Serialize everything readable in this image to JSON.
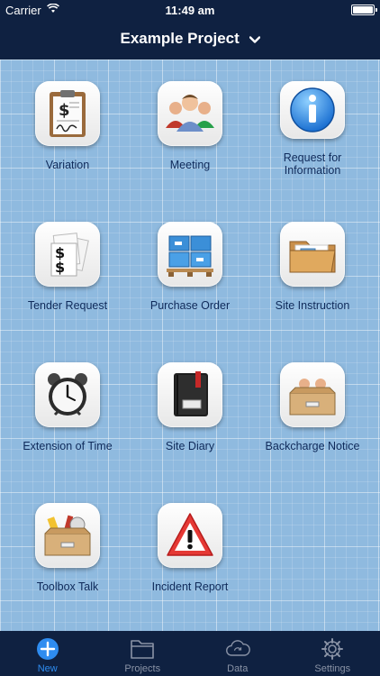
{
  "status": {
    "carrier": "Carrier",
    "time": "11:49 am"
  },
  "header": {
    "title": "Example Project"
  },
  "tiles": [
    {
      "label": "Variation",
      "icon": "clipboard-icon"
    },
    {
      "label": "Meeting",
      "icon": "people-icon"
    },
    {
      "label": "Request for Information",
      "icon": "info-icon"
    },
    {
      "label": "Tender Request",
      "icon": "dollar-docs-icon"
    },
    {
      "label": "Purchase Order",
      "icon": "pallet-boxes-icon"
    },
    {
      "label": "Site Instruction",
      "icon": "folder-icon"
    },
    {
      "label": "Extension of Time",
      "icon": "alarm-clock-icon"
    },
    {
      "label": "Site Diary",
      "icon": "diary-book-icon"
    },
    {
      "label": "Backcharge Notice",
      "icon": "drawer-people-icon"
    },
    {
      "label": "Toolbox Talk",
      "icon": "toolbox-icon"
    },
    {
      "label": "Incident Report",
      "icon": "warning-icon"
    }
  ],
  "tabbar": {
    "tabs": [
      {
        "label": "New",
        "icon": "plus-circle-icon",
        "active": true
      },
      {
        "label": "Projects",
        "icon": "folder-outline-icon",
        "active": false
      },
      {
        "label": "Data",
        "icon": "cloud-sync-icon",
        "active": false
      },
      {
        "label": "Settings",
        "icon": "gear-icon",
        "active": false
      }
    ]
  },
  "colors": {
    "nav_bg": "#0f2141",
    "grid_bg": "#8fbadf",
    "label_text": "#0f2a5a",
    "active_tab": "#2e8cf0",
    "inactive_tab": "#8a93a6"
  }
}
